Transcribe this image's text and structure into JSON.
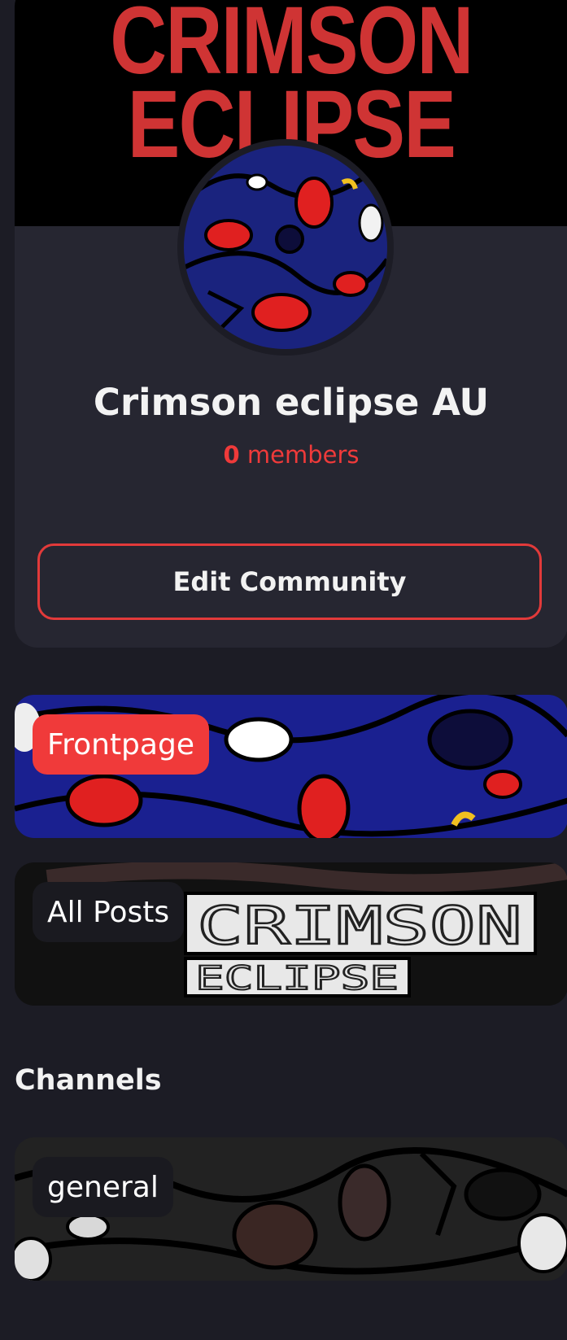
{
  "banner": {
    "line1": "CRIMSON",
    "line2": "ECLIPSE"
  },
  "community": {
    "name": "Crimson eclipse AU",
    "member_count": "0",
    "member_label": "members",
    "edit_button": "Edit Community"
  },
  "nav": {
    "frontpage": "Frontpage",
    "all_posts": "All Posts"
  },
  "all_posts_image_text": {
    "line1": "CRIMSON",
    "line2": "ECLIPSE"
  },
  "channels": {
    "title": "Channels",
    "items": [
      {
        "label": "general"
      }
    ]
  },
  "colors": {
    "accent": "#f03a3a",
    "background": "#1c1c25",
    "card": "#262631",
    "banner_text": "#cf3434"
  }
}
